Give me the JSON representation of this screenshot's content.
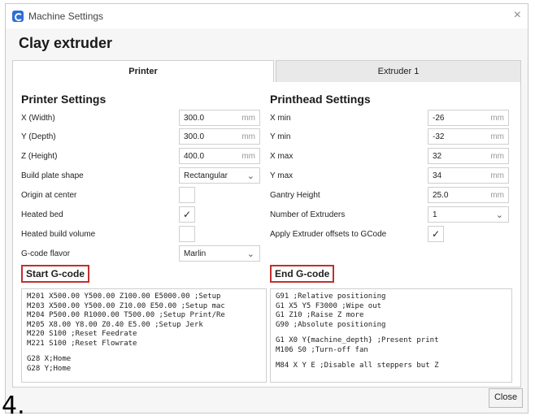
{
  "window": {
    "title": "Machine Settings",
    "close_symbol": "×"
  },
  "machine_name": "Clay extruder",
  "tabs": {
    "printer": "Printer",
    "extruder": "Extruder 1"
  },
  "printer": {
    "heading": "Printer Settings",
    "x_label": "X (Width)",
    "x_value": "300.0",
    "x_unit": "mm",
    "y_label": "Y (Depth)",
    "y_value": "300.0",
    "y_unit": "mm",
    "z_label": "Z (Height)",
    "z_value": "400.0",
    "z_unit": "mm",
    "plate_label": "Build plate shape",
    "plate_value": "Rectangular",
    "origin_label": "Origin at center",
    "heated_bed_label": "Heated bed",
    "heated_bed_check": "✓",
    "heated_volume_label": "Heated build volume",
    "flavor_label": "G-code flavor",
    "flavor_value": "Marlin"
  },
  "printhead": {
    "heading": "Printhead Settings",
    "xmin_label": "X min",
    "xmin_value": "-26",
    "xmin_unit": "mm",
    "ymin_label": "Y min",
    "ymin_value": "-32",
    "ymin_unit": "mm",
    "xmax_label": "X max",
    "xmax_value": "32",
    "xmax_unit": "mm",
    "ymax_label": "Y max",
    "ymax_value": "34",
    "ymax_unit": "mm",
    "gantry_label": "Gantry Height",
    "gantry_value": "25.0",
    "gantry_unit": "mm",
    "extruders_label": "Number of Extruders",
    "extruders_value": "1",
    "offsets_label": "Apply Extruder offsets to GCode",
    "offsets_check": "✓"
  },
  "start_gcode": {
    "heading": "Start G-code",
    "lines": [
      "M201 X500.00 Y500.00 Z100.00 E5000.00 ;Setup",
      "M203 X500.00 Y500.00 Z10.00 E50.00 ;Setup mac",
      "M204 P500.00 R1000.00 T500.00 ;Setup Print/Re",
      "M205 X8.00 Y8.00 Z0.40 E5.00 ;Setup Jerk",
      "M220 S100 ;Reset Feedrate",
      "M221 S100 ;Reset Flowrate",
      "",
      "G28 X;Home",
      "G28 Y;Home"
    ]
  },
  "end_gcode": {
    "heading": "End G-code",
    "lines": [
      "G91 ;Relative positioning",
      "G1 X5 Y5 F3000 ;Wipe out",
      "G1 Z10 ;Raise Z more",
      "G90 ;Absolute positioning",
      "",
      "G1 X0 Y{machine_depth} ;Present print",
      "M106 S0 ;Turn-off fan",
      "",
      "M84 X Y E ;Disable all steppers but Z"
    ]
  },
  "close_label": "Close",
  "annotation": "4."
}
